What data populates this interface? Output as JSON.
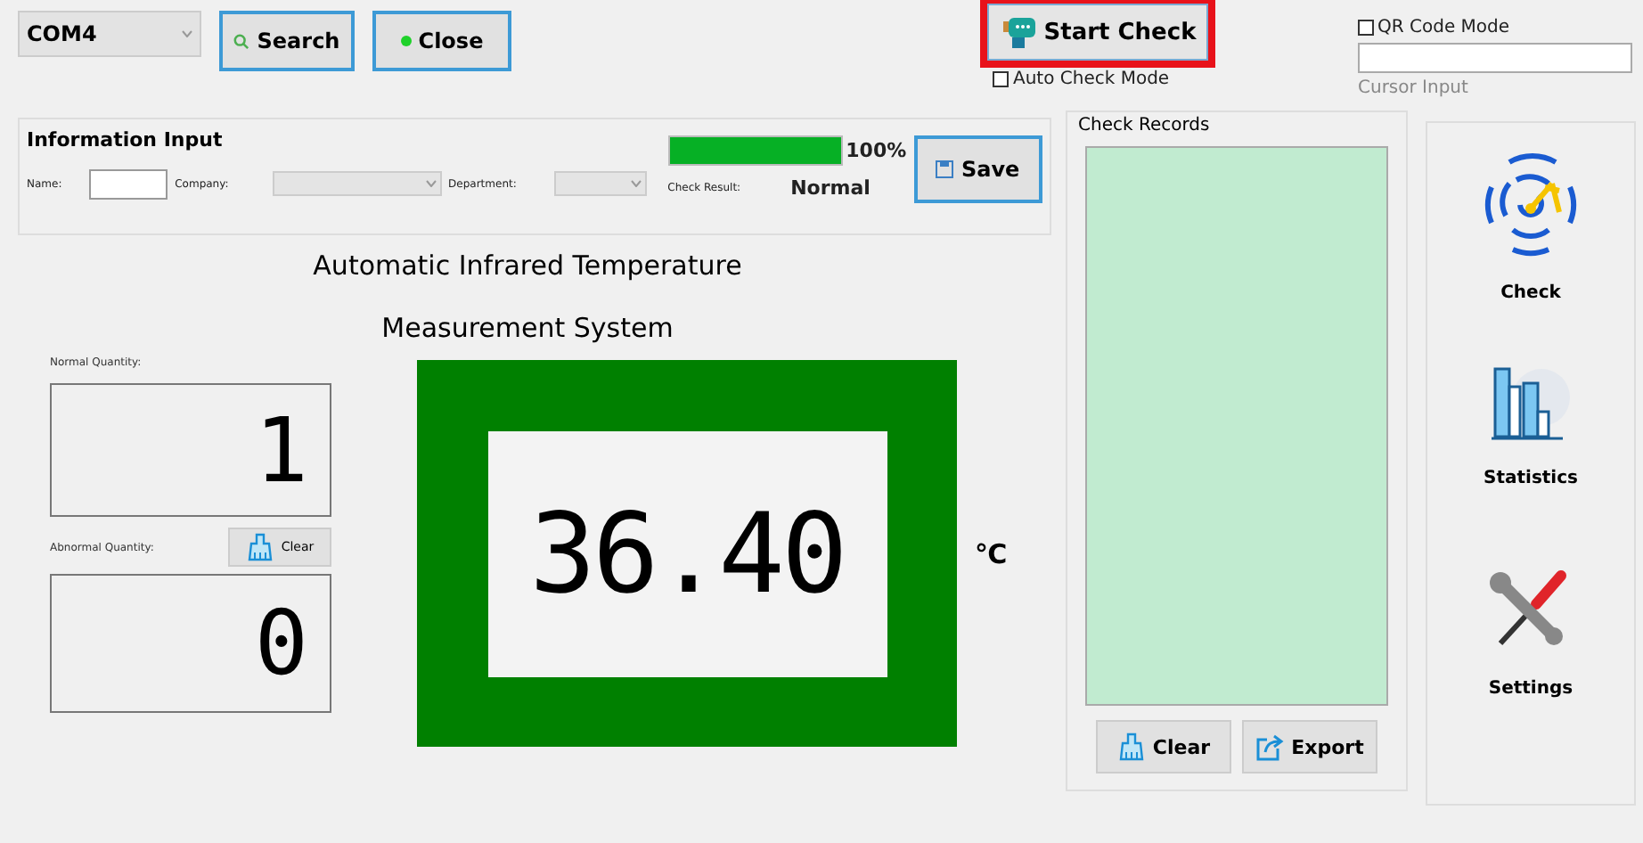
{
  "port": {
    "value": "COM4"
  },
  "buttons": {
    "search": "Search",
    "close": "Close",
    "start_check": "Start Check",
    "start_check_highlighted": true
  },
  "auto_check_mode": {
    "label": "Auto Check Mode",
    "checked": false
  },
  "qr_code_mode": {
    "label": "QR Code Mode",
    "checked": false
  },
  "cursor_input": {
    "label": "Cursor Input"
  },
  "information_input": {
    "title": "Information Input",
    "name_label": "Name:",
    "company_label": "Company:",
    "department_label": "Department:",
    "progress": {
      "level": 1.0,
      "reading": "100%"
    },
    "check_result_label": "Check Result:",
    "check_result": "Normal",
    "save": "Save"
  },
  "title_lines": [
    "Automatic Infrared Temperature",
    "Measurement System"
  ],
  "normal_quantity": {
    "label": "Normal Quantity:",
    "value": "1"
  },
  "abnormal_quantity": {
    "label": "Abnormal Quantity:",
    "value": "0"
  },
  "clear_counts": "Clear",
  "temperature": {
    "value": "36.40",
    "unit": "℃"
  },
  "check_records": {
    "title": "Check Records",
    "clear": "Clear",
    "export": "Export"
  },
  "nav": [
    {
      "kind": "check",
      "label": "Check"
    },
    {
      "kind": "statistics",
      "label": "Statistics"
    },
    {
      "kind": "settings",
      "label": "Settings"
    }
  ]
}
